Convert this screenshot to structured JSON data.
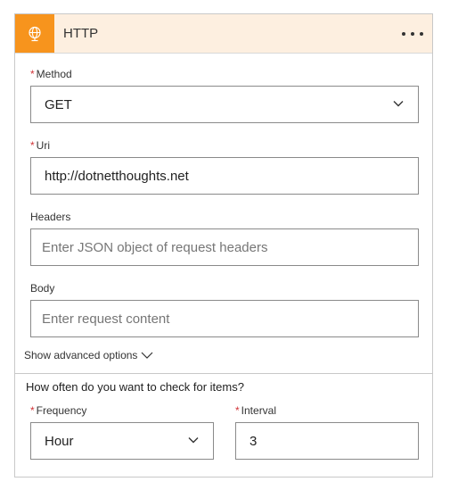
{
  "header": {
    "title": "HTTP",
    "icon": "globe-icon",
    "accent": "#f7941d"
  },
  "method": {
    "label": "Method",
    "required": true,
    "value": "GET"
  },
  "uri": {
    "label": "Uri",
    "required": true,
    "value": "http://dotnetthoughts.net"
  },
  "headers": {
    "label": "Headers",
    "placeholder": "Enter JSON object of request headers"
  },
  "body": {
    "label": "Body",
    "placeholder": "Enter request content"
  },
  "advanced": {
    "label": "Show advanced options"
  },
  "recurrence": {
    "question": "How often do you want to check for items?",
    "frequency": {
      "label": "Frequency",
      "required": true,
      "value": "Hour"
    },
    "interval": {
      "label": "Interval",
      "required": true,
      "value": "3"
    }
  },
  "required_marker": "*"
}
